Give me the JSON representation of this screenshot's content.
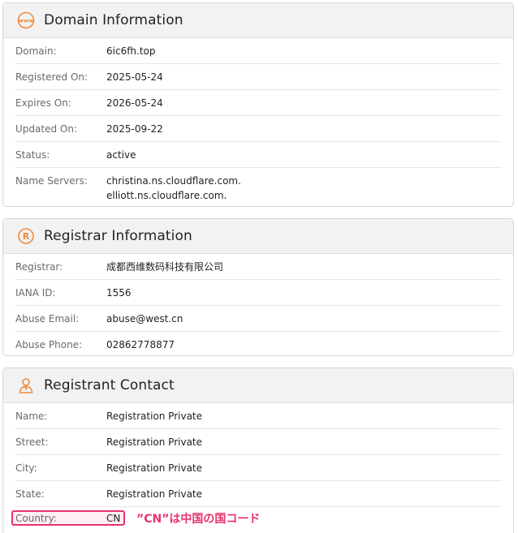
{
  "domain_info": {
    "title": "Domain Information",
    "icon": "www-globe-icon",
    "rows": [
      {
        "label": "Domain:",
        "value": "6ic6fh.top"
      },
      {
        "label": "Registered On:",
        "value": "2025-05-24"
      },
      {
        "label": "Expires On:",
        "value": "2026-05-24"
      },
      {
        "label": "Updated On:",
        "value": "2025-09-22"
      },
      {
        "label": "Status:",
        "value": "active"
      },
      {
        "label": "Name Servers:",
        "value": "christina.ns.cloudflare.com.",
        "value2": "elliott.ns.cloudflare.com."
      }
    ]
  },
  "registrar_info": {
    "title": "Registrar Information",
    "icon": "registered-trademark-icon",
    "rows": [
      {
        "label": "Registrar:",
        "value": "成都西维数码科技有限公司"
      },
      {
        "label": "IANA ID:",
        "value": "1556"
      },
      {
        "label": "Abuse Email:",
        "value": "abuse@west.cn"
      },
      {
        "label": "Abuse Phone:",
        "value": "02862778877"
      }
    ]
  },
  "registrant_contact": {
    "title": "Registrant Contact",
    "icon": "person-icon",
    "rows": [
      {
        "label": "Name:",
        "value": "Registration Private"
      },
      {
        "label": "Street:",
        "value": "Registration Private"
      },
      {
        "label": "City:",
        "value": "Registration Private"
      },
      {
        "label": "State:",
        "value": "Registration Private"
      }
    ],
    "country": {
      "label": "Country:",
      "value": "CN"
    }
  },
  "annotation": "”CN”は中国の国コード",
  "colors": {
    "accent": "#f0893c",
    "highlight": "#e8336b"
  }
}
